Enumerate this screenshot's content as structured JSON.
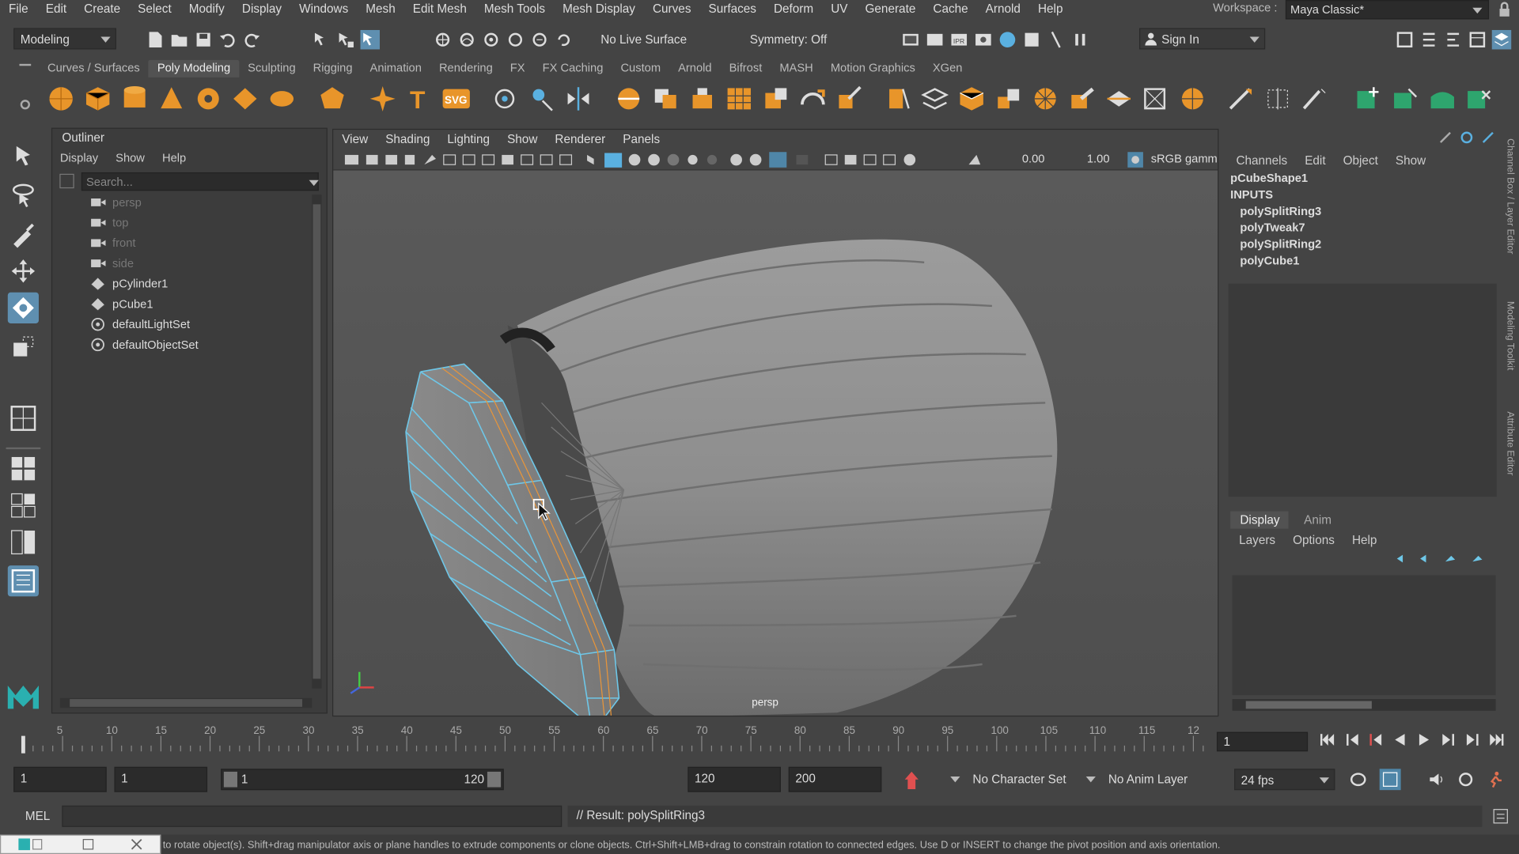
{
  "menu": [
    "File",
    "Edit",
    "Create",
    "Select",
    "Modify",
    "Display",
    "Windows",
    "Mesh",
    "Edit Mesh",
    "Mesh Tools",
    "Mesh Display",
    "Curves",
    "Surfaces",
    "Deform",
    "UV",
    "Generate",
    "Cache",
    "Arnold",
    "Help"
  ],
  "workspace": {
    "label": "Workspace :",
    "value": "Maya Classic*"
  },
  "status": {
    "mode": "Modeling",
    "live_surface": "No Live Surface",
    "symmetry": "Symmetry: Off",
    "sign_in": "Sign In"
  },
  "shelf_tabs": [
    "Curves / Surfaces",
    "Poly Modeling",
    "Sculpting",
    "Rigging",
    "Animation",
    "Rendering",
    "FX",
    "FX Caching",
    "Custom",
    "Arnold",
    "Bifrost",
    "MASH",
    "Motion Graphics",
    "XGen"
  ],
  "shelf_active": "Poly Modeling",
  "outliner": {
    "title": "Outliner",
    "menu": [
      "Display",
      "Show",
      "Help"
    ],
    "search_placeholder": "Search...",
    "items": [
      {
        "label": "persp",
        "type": "camera",
        "dim": true
      },
      {
        "label": "top",
        "type": "camera",
        "dim": true
      },
      {
        "label": "front",
        "type": "camera",
        "dim": true
      },
      {
        "label": "side",
        "type": "camera",
        "dim": true
      },
      {
        "label": "pCylinder1",
        "type": "mesh",
        "dim": false
      },
      {
        "label": "pCube1",
        "type": "mesh",
        "dim": false
      },
      {
        "label": "defaultLightSet",
        "type": "set",
        "dim": false
      },
      {
        "label": "defaultObjectSet",
        "type": "set",
        "dim": false
      }
    ]
  },
  "viewport": {
    "menu": [
      "View",
      "Shading",
      "Lighting",
      "Show",
      "Renderer",
      "Panels"
    ],
    "exposure": "0.00",
    "gamma": "1.00",
    "colorspace": "sRGB gamma",
    "camera": "persp"
  },
  "channelbox": {
    "menu": [
      "Channels",
      "Edit",
      "Object",
      "Show"
    ],
    "shape": "pCubeShape1",
    "inputs_label": "INPUTS",
    "inputs": [
      "polySplitRing3",
      "polyTweak7",
      "polySplitRing2",
      "polyCube1"
    ]
  },
  "layers": {
    "tabs": [
      "Display",
      "Anim"
    ],
    "menu": [
      "Layers",
      "Options",
      "Help"
    ]
  },
  "side_tabs": [
    "Channel Box / Layer Editor",
    "Modeling Toolkit",
    "Attribute Editor"
  ],
  "timeline": {
    "ticks": [
      "5",
      "10",
      "15",
      "20",
      "25",
      "30",
      "35",
      "40",
      "45",
      "50",
      "55",
      "60",
      "65",
      "70",
      "75",
      "80",
      "85",
      "90",
      "95",
      "100",
      "105",
      "110",
      "115",
      "12"
    ],
    "current_frame": "1"
  },
  "range": {
    "start": "1",
    "playback_start": "1",
    "slider_start": "1",
    "slider_end": "120",
    "playback_end": "120",
    "end": "200",
    "character_set": "No Character Set",
    "anim_layer": "No Anim Layer",
    "fps": "24 fps"
  },
  "command": {
    "lang": "MEL",
    "result": "// Result: polySplitRing3"
  },
  "helpline": "to rotate object(s). Shift+drag manipulator axis or plane handles to extrude components or clone objects. Ctrl+Shift+LMB+drag to constrain rotation to connected edges. Use D or INSERT to change the pivot position and axis orientation."
}
